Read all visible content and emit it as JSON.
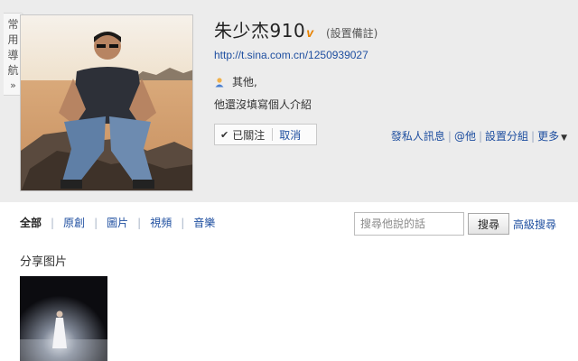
{
  "side_nav": {
    "chars": [
      "常",
      "用",
      "導",
      "航"
    ],
    "arrow": "»"
  },
  "profile": {
    "name": "朱少杰910",
    "verified_mark": "v",
    "remark_link": "(設置備註)",
    "url": "http://t.sina.com.cn/1250939027",
    "location": "其他,",
    "bio": "他還沒填寫個人介紹",
    "follow_status": "已關注",
    "cancel_link": "取消"
  },
  "actions": {
    "items": [
      "發私人訊息",
      "@他",
      "設置分組",
      "更多"
    ],
    "separator": "|"
  },
  "tabs": {
    "items": [
      "全部",
      "原創",
      "圖片",
      "視頻",
      "音樂"
    ],
    "separator": "|"
  },
  "search": {
    "placeholder": "搜尋他說的話",
    "button_label": "搜尋",
    "advanced_label": "高級搜尋"
  },
  "section": {
    "title": "分享图片"
  },
  "colors": {
    "link": "#1f4fa0",
    "header_band": "#ececec",
    "verified": "#e88200"
  }
}
